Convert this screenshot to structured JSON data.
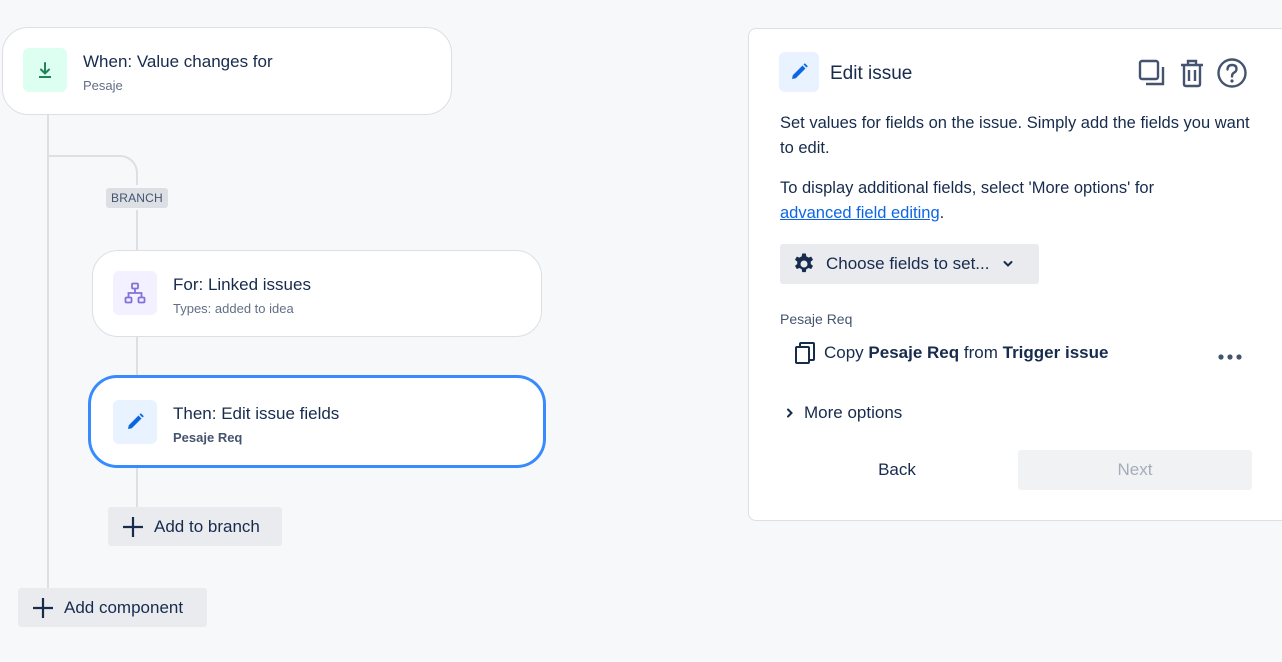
{
  "trigger": {
    "title": "When: Value changes for",
    "subtitle": "Pesaje"
  },
  "branch_tag": "BRANCH",
  "branch_card": {
    "title": "For: Linked issues",
    "subtitle": "Types: added to idea"
  },
  "action_card": {
    "title": "Then: Edit issue fields",
    "subtitle": "Pesaje Req"
  },
  "add_to_branch": "Add to branch",
  "add_component": "Add component",
  "panel": {
    "title": "Edit issue",
    "desc1": "Set values for fields on the issue. Simply add the fields you want to edit.",
    "desc2_prefix": "To display additional fields, select 'More options' for",
    "desc2_link": "advanced field editing",
    "desc2_suffix": ".",
    "choose_fields": "Choose fields to set...",
    "field_label": "Pesaje Req",
    "copy_prefix": "Copy",
    "copy_field": "Pesaje Req",
    "copy_mid": "from",
    "copy_source": "Trigger issue",
    "more_options": "More options",
    "back": "Back",
    "next": "Next"
  },
  "icons": {
    "trigger": "download-arrow-icon",
    "branch": "hierarchy-icon",
    "action": "pencil-icon",
    "duplicate": "duplicate-icon",
    "delete": "trash-icon",
    "help": "help-icon",
    "gear": "gear-icon",
    "copy": "copy-icon",
    "more": "more-horizontal-icon",
    "chevron_right": "chevron-right-icon",
    "chevron_down": "chevron-down-icon"
  },
  "colors": {
    "accent": "#0c66e4",
    "selected_border": "#388bff",
    "trigger_icon_bg": "#dcfff1",
    "trigger_icon": "#1f845a",
    "branch_icon_bg": "#f3f0ff",
    "branch_icon": "#8270db",
    "action_icon_bg": "#e9f2ff"
  }
}
